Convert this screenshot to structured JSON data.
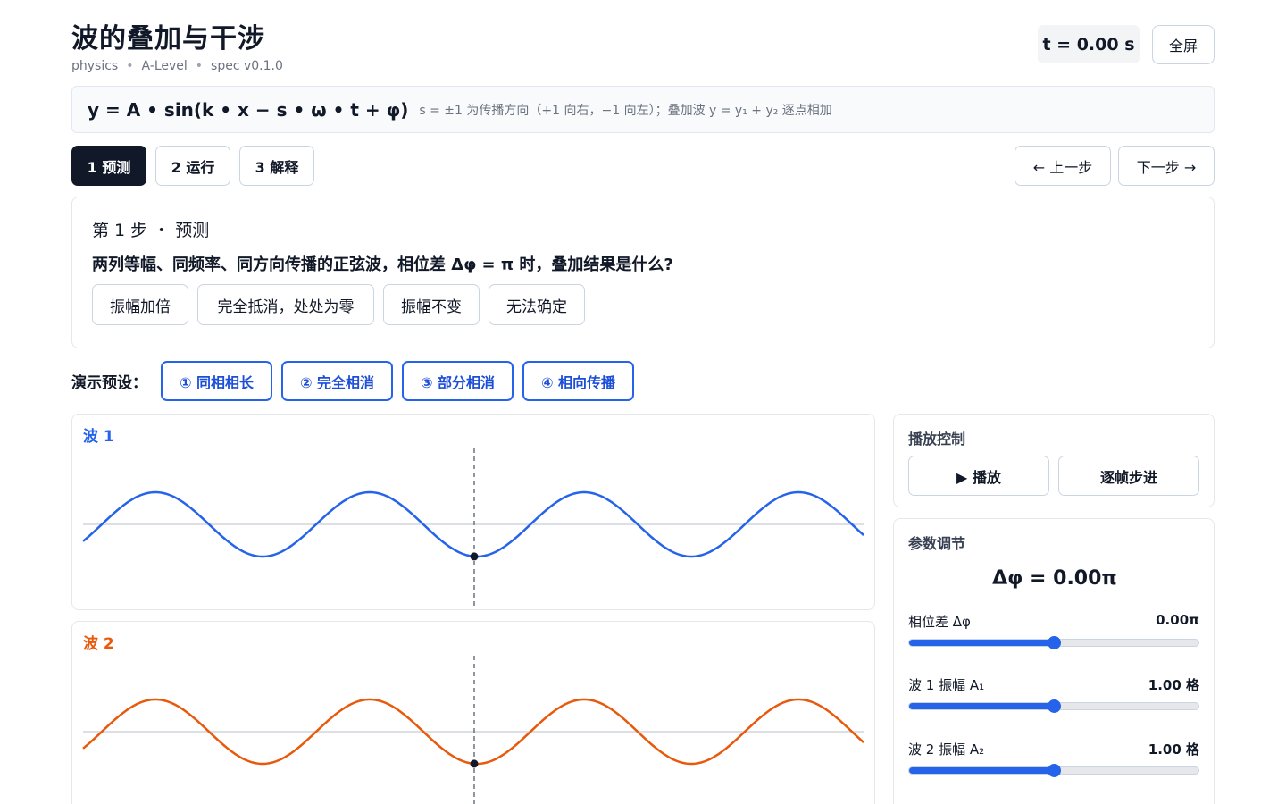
{
  "header": {
    "title": "波的叠加与干涉",
    "meta": [
      "physics",
      "A-Level",
      "spec v0.1.0"
    ],
    "time": "t = 0.00 s",
    "fullscreen_label": "全屏"
  },
  "formula": {
    "expression": "y = A • sin(k • x − s • ω • t + φ)",
    "note": "s = ±1 为传播方向（+1 向右，−1 向左）；叠加波 y = y₁ + y₂ 逐点相加"
  },
  "steps": [
    {
      "label": "1 预测",
      "active": true
    },
    {
      "label": "2 运行",
      "active": false
    },
    {
      "label": "3 解释",
      "active": false
    }
  ],
  "nav": {
    "prev_label": "← 上一步",
    "next_label": "下一步 →"
  },
  "prompt": {
    "step_label": "第 1 步 ・ 预测",
    "question": "两列等幅、同频率、同方向传播的正弦波，相位差 Δφ = π 时，叠加结果是什么?",
    "choices": [
      "振幅加倍",
      "完全抵消，处处为零",
      "振幅不变",
      "无法确定"
    ]
  },
  "presets": {
    "label": "演示预设：",
    "items": [
      "① 同相相长",
      "② 完全相消",
      "③ 部分相消",
      "④ 相向传播"
    ]
  },
  "waves": [
    {
      "name": "波 1",
      "color": "#2563eb",
      "amplitude": 1.0,
      "phase_pi": 0.0
    },
    {
      "name": "波 2",
      "color": "#e8590c",
      "amplitude": 1.0,
      "phase_pi": 0.0
    }
  ],
  "playback": {
    "title": "播放控制",
    "play_label": "▶ 播放",
    "step_label": "逐帧步进"
  },
  "params": {
    "title": "参数调节",
    "headline": "Δφ = 0.00π",
    "rows": [
      {
        "label": "相位差 Δφ",
        "value": "0.00π",
        "fraction": 0.5
      },
      {
        "label": "波 1 振幅 A₁",
        "value": "1.00 格",
        "fraction": 0.5
      },
      {
        "label": "波 2 振幅 A₂",
        "value": "1.00 格",
        "fraction": 0.5
      }
    ]
  },
  "colors": {
    "accent": "#2563eb",
    "wave1": "#2563eb",
    "wave2": "#e8590c",
    "dark": "#111827"
  }
}
